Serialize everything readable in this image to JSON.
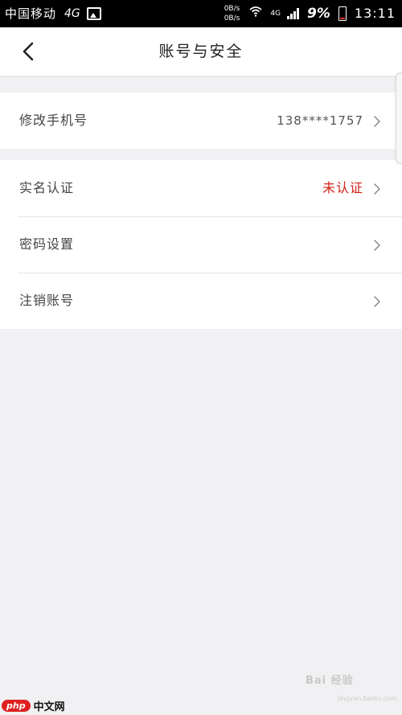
{
  "status_bar": {
    "carrier": "中国移动",
    "network": "4G",
    "speed_up": "0B/s",
    "speed_down": "0B/s",
    "cell_type": "4G",
    "battery_pct": "9%",
    "time": "13:11"
  },
  "header": {
    "title": "账号与安全"
  },
  "groups": [
    {
      "rows": [
        {
          "label": "修改手机号",
          "value": "138****1757"
        }
      ]
    },
    {
      "rows": [
        {
          "label": "实名认证",
          "value": "未认证"
        },
        {
          "label": "密码设置",
          "value": ""
        },
        {
          "label": "注销账号",
          "value": ""
        }
      ]
    }
  ],
  "colors": {
    "accent_red": "#d4211a",
    "background": "#f1f1f3"
  },
  "watermark": {
    "text": "Bai 经验",
    "sub": "jingyan.baidu.com",
    "php_badge": "php",
    "php_text": "中文网"
  }
}
